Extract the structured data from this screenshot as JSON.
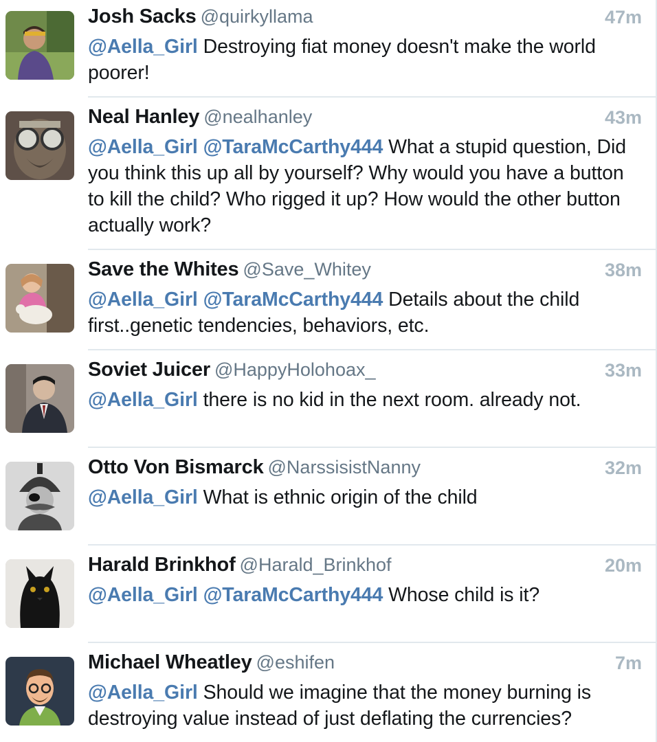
{
  "tweets": [
    {
      "name": "Josh Sacks",
      "handle": "@quirkyllama",
      "time": "47m",
      "avatar": "avatar-josh-sacks",
      "mentions": [
        "@Aella_Girl"
      ],
      "text": "Destroying fiat money doesn't make the world poorer!"
    },
    {
      "name": "Neal Hanley",
      "handle": "@nealhanley",
      "time": "43m",
      "avatar": "avatar-neal-hanley",
      "mentions": [
        "@Aella_Girl",
        "@TaraMcCarthy444"
      ],
      "text": "What a stupid question, Did you think this up all by yourself? Why would you have a button to kill the child? Who rigged it up? How would the other button actually work?"
    },
    {
      "name": "Save the Whites",
      "handle": "@Save_Whitey",
      "time": "38m",
      "avatar": "avatar-save-the-whites",
      "mentions": [
        "@Aella_Girl",
        "@TaraMcCarthy444"
      ],
      "text": "Details about the child first..genetic tendencies, behaviors, etc."
    },
    {
      "name": "Soviet Juicer",
      "handle": "@HappyHolohoax_",
      "time": "33m",
      "avatar": "avatar-soviet-juicer",
      "mentions": [
        "@Aella_Girl"
      ],
      "text": "there is no kid in the next room. already not."
    },
    {
      "name": "Otto Von Bismarck",
      "handle": "@NarssisistNanny",
      "time": "32m",
      "avatar": "avatar-otto-von-bismarck",
      "mentions": [
        "@Aella_Girl"
      ],
      "text": "What is ethnic origin of the child"
    },
    {
      "name": "Harald Brinkhof",
      "handle": "@Harald_Brinkhof",
      "time": "20m",
      "avatar": "avatar-harald-brinkhof",
      "mentions": [
        "@Aella_Girl",
        "@TaraMcCarthy444"
      ],
      "text": "Whose child is it?"
    },
    {
      "name": "Michael Wheatley",
      "handle": "@eshifen",
      "time": "7m",
      "avatar": "avatar-michael-wheatley",
      "mentions": [
        "@Aella_Girl"
      ],
      "text": "Should we imagine that the money burning is destroying value instead of just deflating the currencies?"
    }
  ]
}
